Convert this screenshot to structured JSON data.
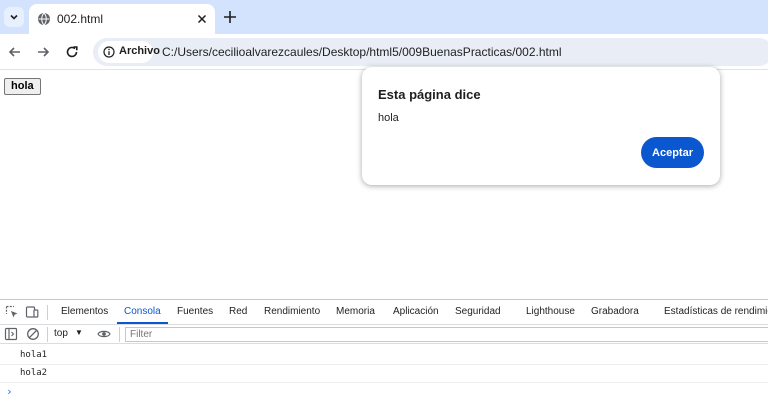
{
  "browser": {
    "tab": {
      "title": "002.html"
    },
    "address": {
      "chip_label": "Archivo",
      "url": "C:/Users/cecilioalvarezcaules/Desktop/html5/009BuenasPracticas/002.html"
    }
  },
  "page": {
    "button_label": "hola"
  },
  "dialog": {
    "title": "Esta página dice",
    "message": "hola",
    "ok_label": "Aceptar",
    "accent": "#0b57d0"
  },
  "devtools": {
    "tabs": [
      {
        "label": "Elementos"
      },
      {
        "label": "Consola"
      },
      {
        "label": "Fuentes"
      },
      {
        "label": "Red"
      },
      {
        "label": "Rendimiento"
      },
      {
        "label": "Memoria"
      },
      {
        "label": "Aplicación"
      },
      {
        "label": "Seguridad"
      },
      {
        "label": "Lighthouse"
      },
      {
        "label": "Grabadora"
      },
      {
        "label": "Estadísticas de rendimier"
      }
    ],
    "active_tab": "Consola",
    "context": "top",
    "filter_placeholder": "Filter",
    "logs": [
      "hola1",
      "hola2"
    ],
    "prompt": "›"
  }
}
